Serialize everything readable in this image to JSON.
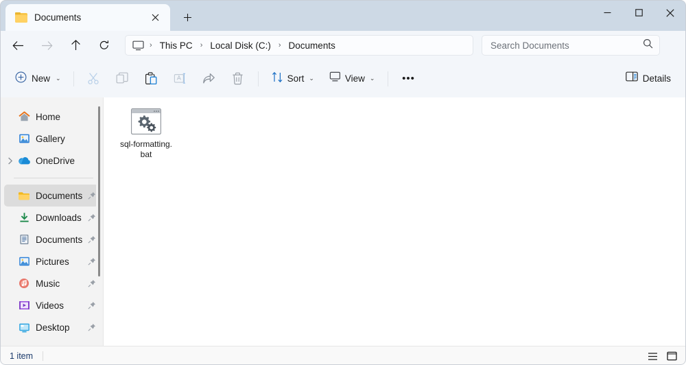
{
  "window": {
    "controls": {
      "minimize_label": "Minimize",
      "maximize_label": "Maximize",
      "close_label": "Close"
    }
  },
  "tabs": {
    "items": [
      {
        "label": "Documents",
        "icon": "folder-icon",
        "active": true
      }
    ],
    "close_label": "Close tab",
    "new_tab_label": "New tab"
  },
  "address": {
    "back_label": "Back",
    "forward_label": "Forward",
    "up_label": "Up",
    "refresh_label": "Refresh",
    "crumbs": [
      {
        "label": "This PC"
      },
      {
        "label": "Local Disk (C:)"
      },
      {
        "label": "Documents"
      }
    ],
    "separator": "›",
    "pc_icon": "monitor-icon"
  },
  "search": {
    "placeholder": "Search Documents",
    "value": "",
    "icon": "search-icon"
  },
  "toolbar": {
    "new_label": "New",
    "new_icon": "plus-circle-icon",
    "cut_label": "Cut",
    "copy_label": "Copy",
    "paste_label": "Paste",
    "rename_label": "Rename",
    "share_label": "Share",
    "delete_label": "Delete",
    "sort_label": "Sort",
    "view_label": "View",
    "more_label": "See more",
    "more_glyph": "•••",
    "details_label": "Details",
    "chevron": "⌄"
  },
  "sidebar": {
    "items": [
      {
        "label": "Home",
        "icon": "home-icon",
        "pinned": false,
        "expander": false,
        "selected": false
      },
      {
        "label": "Gallery",
        "icon": "gallery-icon",
        "pinned": false,
        "expander": false,
        "selected": false
      },
      {
        "label": "OneDrive",
        "icon": "onedrive-icon",
        "pinned": false,
        "expander": true,
        "selected": false
      },
      {
        "label": "Documents",
        "icon": "folder-icon",
        "pinned": true,
        "expander": false,
        "selected": true
      },
      {
        "label": "Downloads",
        "icon": "downloads-icon",
        "pinned": true,
        "expander": false,
        "selected": false
      },
      {
        "label": "Documents",
        "icon": "document-icon",
        "pinned": true,
        "expander": false,
        "selected": false
      },
      {
        "label": "Pictures",
        "icon": "pictures-icon",
        "pinned": true,
        "expander": false,
        "selected": false
      },
      {
        "label": "Music",
        "icon": "music-icon",
        "pinned": true,
        "expander": false,
        "selected": false
      },
      {
        "label": "Videos",
        "icon": "videos-icon",
        "pinned": true,
        "expander": false,
        "selected": false
      },
      {
        "label": "Desktop",
        "icon": "desktop-icon",
        "pinned": true,
        "expander": false,
        "selected": false
      }
    ]
  },
  "files": {
    "items": [
      {
        "name": "sql-formatting.bat",
        "icon": "bat-script-icon",
        "selected": false
      }
    ]
  },
  "status": {
    "count_text": "1 item",
    "details_view_label": "Details view",
    "icons_view_label": "Large icons view"
  },
  "colors": {
    "titlebar": "#cdd9e5",
    "toolbar": "#f3f6fa",
    "sidebar": "#f3f3f3",
    "content": "#ffffff",
    "accent": "#0f6cbd",
    "selection": "#dcdcdc",
    "status_text": "#1b3a6b",
    "folder_yellow": "#ffd264"
  }
}
